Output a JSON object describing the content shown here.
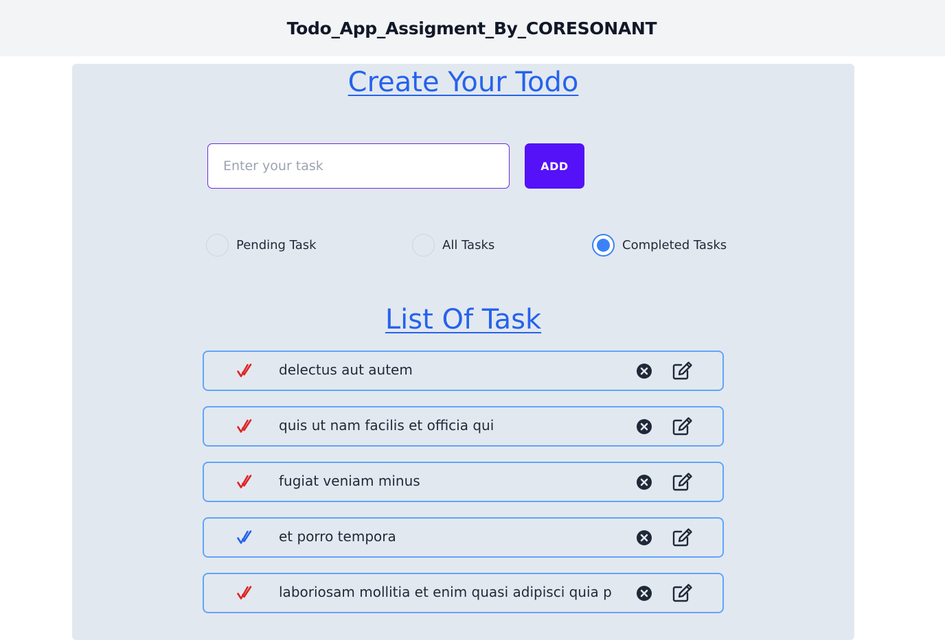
{
  "header": {
    "title": "Todo_App_Assigment_By_CORESONANT"
  },
  "create": {
    "heading": "Create Your Todo",
    "input_placeholder": "Enter your task",
    "input_value": "",
    "add_label": "ADD"
  },
  "filters": [
    {
      "label": "Pending Task",
      "checked": false
    },
    {
      "label": "All Tasks",
      "checked": false
    },
    {
      "label": "Completed Tasks",
      "checked": true
    }
  ],
  "list": {
    "heading": "List Of Task",
    "tasks": [
      {
        "text": "delectus aut autem",
        "check_color": "#dc2626",
        "check_icon": "double-check-icon"
      },
      {
        "text": "quis ut nam facilis et officia qui",
        "check_color": "#dc2626",
        "check_icon": "double-check-icon"
      },
      {
        "text": "fugiat veniam minus",
        "check_color": "#dc2626",
        "check_icon": "double-check-icon"
      },
      {
        "text": "et porro tempora",
        "check_color": "#2563eb",
        "check_icon": "double-check-icon"
      },
      {
        "text": "laboriosam mollitia et enim quasi adipisci quia provident illum",
        "check_color": "#dc2626",
        "check_icon": "double-check-icon"
      }
    ]
  },
  "colors": {
    "accent": "#2563eb",
    "add_button": "#5511f7",
    "panel_bg": "#e2e8f0",
    "row_border": "#60a5fa"
  }
}
